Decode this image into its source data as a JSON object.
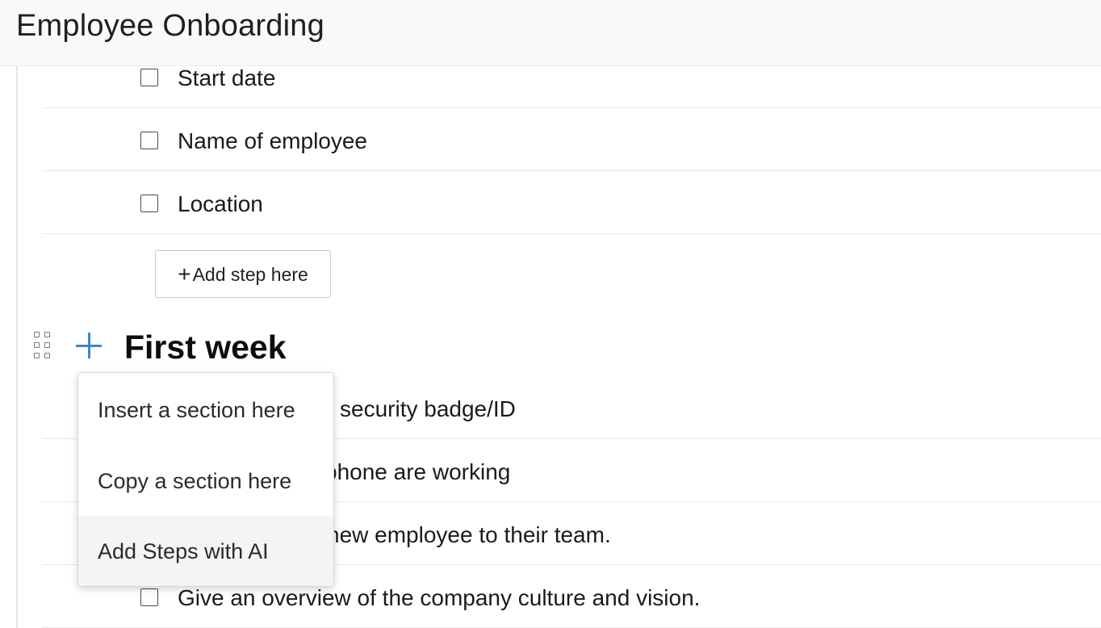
{
  "header": {
    "title": "Employee Onboarding"
  },
  "pre_steps": [
    {
      "label": "Start date"
    },
    {
      "label": "Name of employee"
    },
    {
      "label": "Location"
    }
  ],
  "add_step": {
    "label": "Add step here",
    "icon": "plus-icon"
  },
  "section": {
    "title": "First week",
    "icons": [
      "drag-grip-icon",
      "add-plus-icon"
    ],
    "accent_color": "#3f87c2"
  },
  "section_steps": [
    {
      "label_visible": "security badge/ID"
    },
    {
      "label_visible": "phone are working"
    },
    {
      "label_visible": "new employee to their team."
    },
    {
      "label": "Give an overview of the company culture and vision."
    }
  ],
  "context_menu": {
    "items": [
      {
        "label": "Insert a section here"
      },
      {
        "label": "Copy a section here"
      },
      {
        "label": "Add Steps with AI",
        "highlighted": true
      }
    ]
  }
}
